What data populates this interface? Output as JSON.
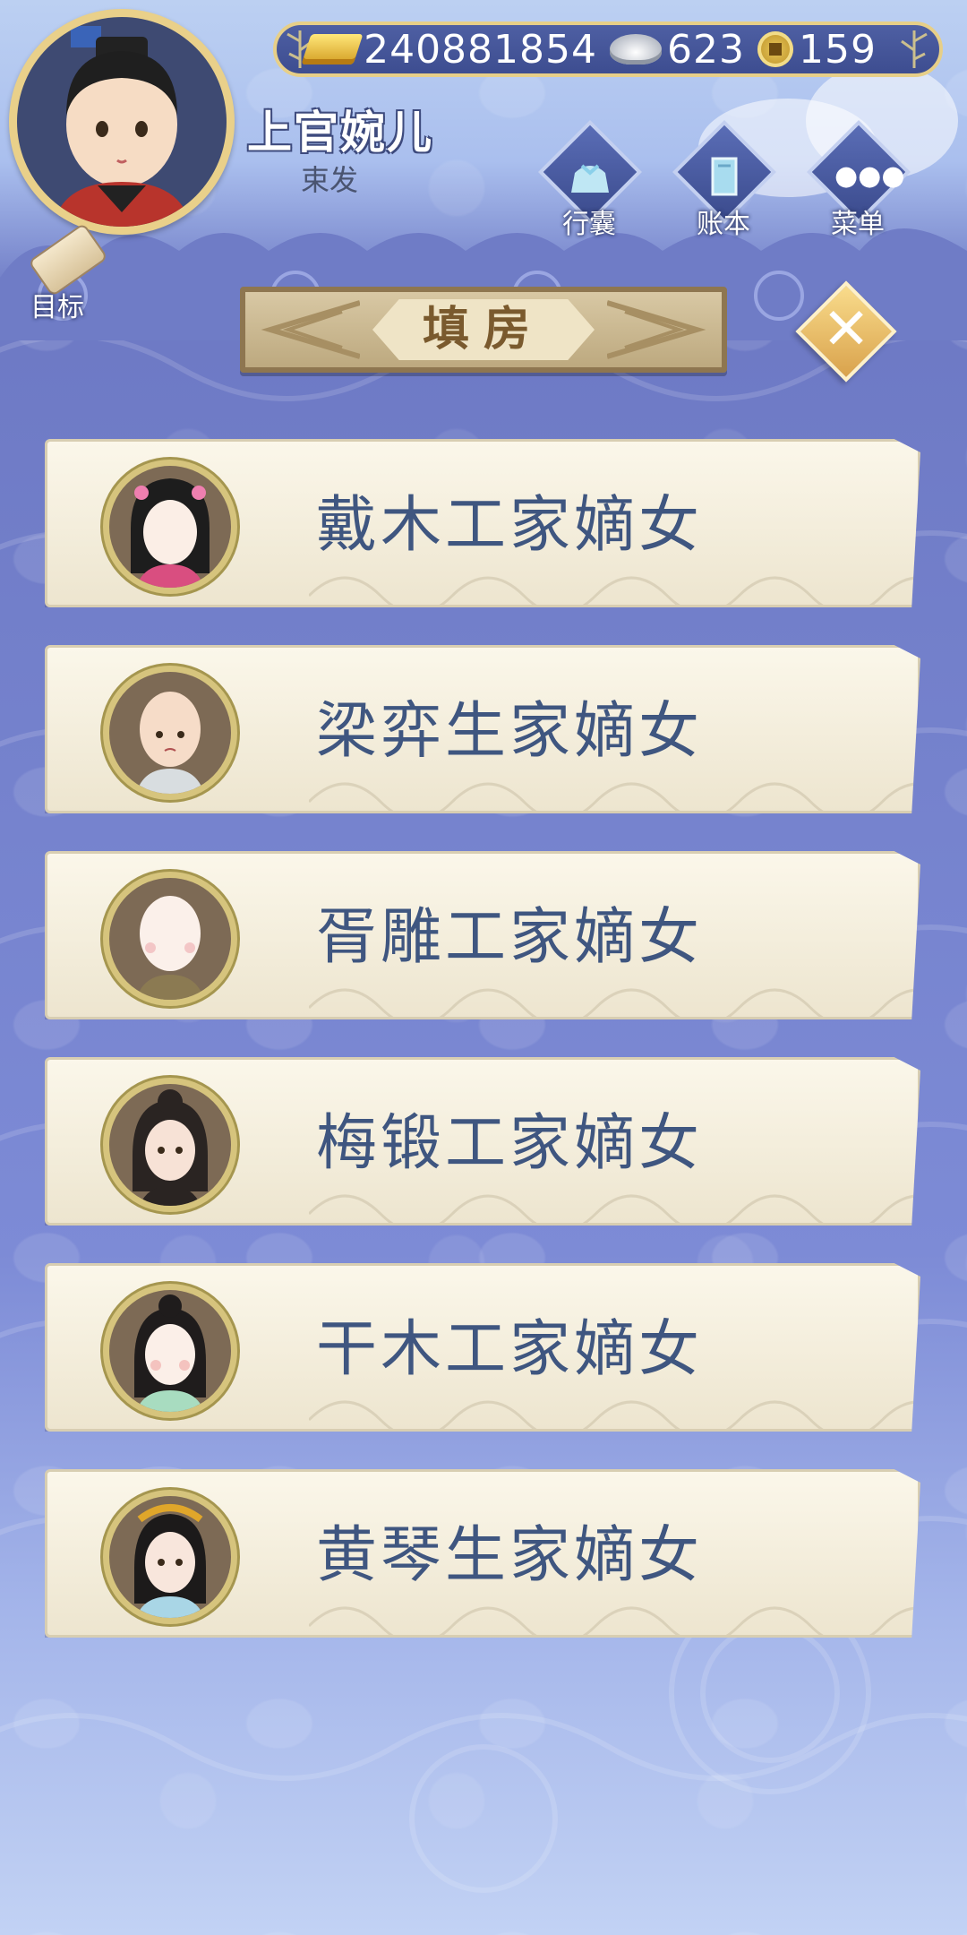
{
  "currency": {
    "gold": "240881854",
    "silver": "623",
    "coin": "159"
  },
  "player": {
    "name": "上官婉儿",
    "title": "束发"
  },
  "menu": {
    "bag_label": "行囊",
    "ledger_label": "账本",
    "more_label": "菜单",
    "goal_label": "目标"
  },
  "page": {
    "title": "填房"
  },
  "candidates": [
    {
      "name": "戴木工家嫡女"
    },
    {
      "name": "梁弈生家嫡女"
    },
    {
      "name": "胥雕工家嫡女"
    },
    {
      "name": "梅锻工家嫡女"
    },
    {
      "name": "干木工家嫡女"
    },
    {
      "name": "黄琴生家嫡女"
    }
  ],
  "colors": {
    "background_top": "#bcd0f2",
    "background_mid": "#7d8bd6",
    "card": "#fbf7ea",
    "candidate_text": "#3f5680",
    "banner": "#bda97f",
    "close": "#d9a24c"
  }
}
